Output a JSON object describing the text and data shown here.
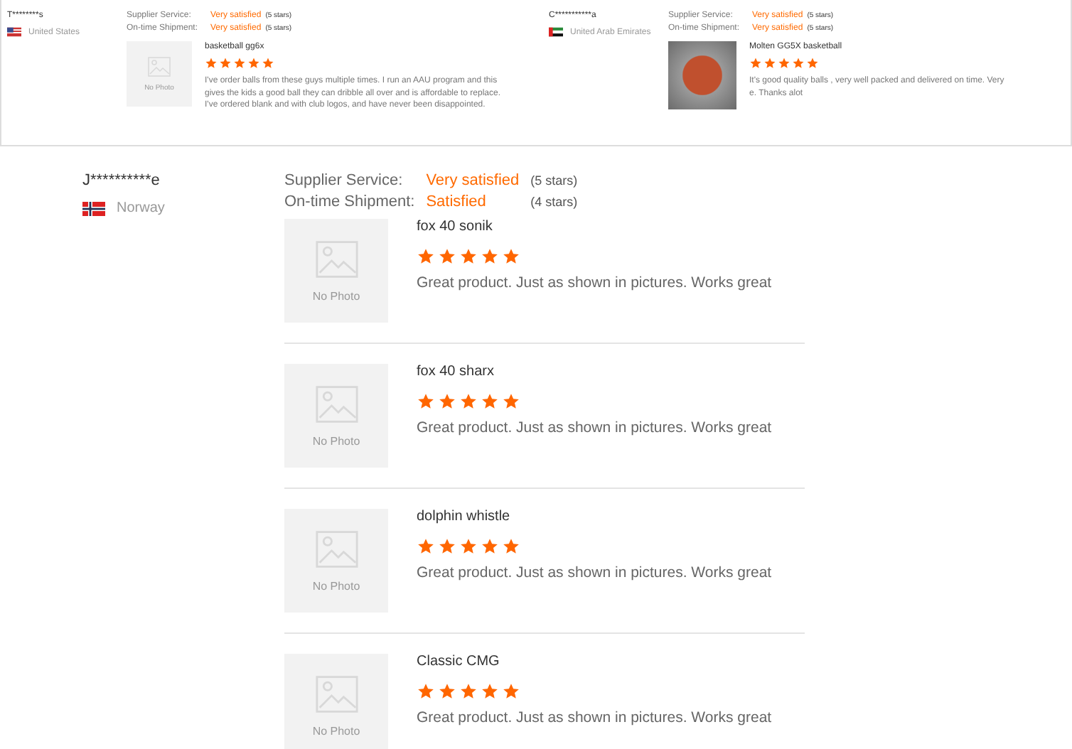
{
  "top_reviews": [
    {
      "user": "T********s",
      "flag": {
        "kind": "us"
      },
      "country": "United States",
      "ratings": [
        {
          "label": "Supplier Service:",
          "value": "Very satisfied",
          "stars_text": "(5 stars)"
        },
        {
          "label": "On-time Shipment:",
          "value": "Very satisfied",
          "stars_text": "(5 stars)"
        }
      ],
      "item": {
        "kind": "no_photo",
        "photo_text": "No Photo",
        "name": "basketball gg6x",
        "stars": 5,
        "text_lines": [
          "I've order balls from these guys multiple times. I run an AAU program and this",
          "gives the kids a good ball they can dribble all over and is affordable to replace.",
          "I've ordered blank and with club logos, and have never been disappointed."
        ]
      }
    },
    {
      "user": "C***********a",
      "flag": {
        "kind": "ae"
      },
      "country": "United Arab Emirates",
      "ratings": [
        {
          "label": "Supplier Service:",
          "value": "Very satisfied",
          "stars_text": "(5 stars)"
        },
        {
          "label": "On-time Shipment:",
          "value": "Very satisfied",
          "stars_text": "(5 stars)"
        }
      ],
      "item": {
        "kind": "photo",
        "name": "Molten GG5X basketball",
        "stars": 5,
        "text_lines": [
          "It's good quality balls , very well packed and delivered on time. Very",
          "e. Thanks alot"
        ]
      }
    }
  ],
  "main_review": {
    "user": "J**********e",
    "flag": {
      "kind": "no"
    },
    "country": "Norway",
    "ratings": [
      {
        "label": "Supplier Service:",
        "value": "Very satisfied",
        "stars_text": "(5 stars)"
      },
      {
        "label": "On-time Shipment:",
        "value": "Satisfied",
        "stars_text": "(4 stars)"
      }
    ],
    "items": [
      {
        "photo_text": "No Photo",
        "name": "fox 40 sonik",
        "stars": 5,
        "text": "Great product. Just as shown in pictures. Works great"
      },
      {
        "photo_text": "No Photo",
        "name": "fox 40 sharx",
        "stars": 5,
        "text": "Great product. Just as shown in pictures. Works great"
      },
      {
        "photo_text": "No Photo",
        "name": "dolphin whistle",
        "stars": 5,
        "text": "Great product. Just as shown in pictures. Works great"
      },
      {
        "photo_text": "No Photo",
        "name": "Classic CMG",
        "stars": 5,
        "text": "Great product. Just as shown in pictures. Works great"
      }
    ]
  }
}
